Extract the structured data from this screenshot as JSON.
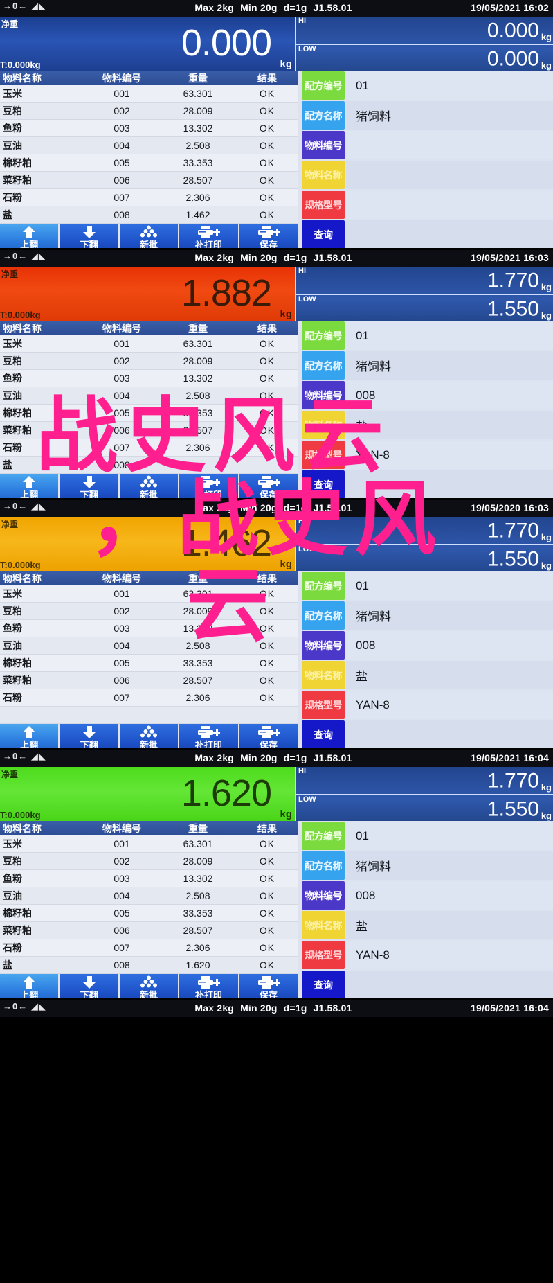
{
  "device": {
    "spec": {
      "max": "Max 2kg",
      "min": "Min 20g",
      "division": "d=1g",
      "version": "J1.58.01"
    },
    "status_icons": "→ 0 ←   ▼▼",
    "net_label": "净重",
    "unit": "kg",
    "hi_tag": "HI",
    "low_tag": "LOW"
  },
  "table": {
    "headers": [
      "物料名称",
      "物料编号",
      "重量",
      "结果"
    ]
  },
  "side_keys": [
    {
      "label": "配方编号",
      "color": "k-green"
    },
    {
      "label": "配方名称",
      "color": "k-blue"
    },
    {
      "label": "物料编号",
      "color": "k-purple"
    },
    {
      "label": "物料名称",
      "color": "k-yellow"
    },
    {
      "label": "规格型号",
      "color": "k-red"
    },
    {
      "label": "查询",
      "color": "k-navy"
    }
  ],
  "nav_buttons": [
    {
      "label": "上翻",
      "icon": "arrow-up-icon"
    },
    {
      "label": "下翻",
      "icon": "arrow-down-icon"
    },
    {
      "label": "新批",
      "icon": "batch-stack-icon"
    },
    {
      "label": "补打印",
      "icon": "printer-plus-icon"
    },
    {
      "label": "保存",
      "icon": "printer-plus-icon"
    }
  ],
  "watermark": {
    "line1": "战史风云",
    "line2": "，战史风",
    "line3": "云"
  },
  "colors": {
    "blue_display": "#2a55b5",
    "red_display": "#f04a12",
    "orange_display": "#f7b71a",
    "green_display": "#64e636",
    "watermark": "#ff1f8f",
    "key_green": "#7ada3e",
    "key_blue": "#36a3ee",
    "key_purple": "#4b37c8",
    "key_yellow": "#f0d433",
    "key_red": "#f03a42",
    "key_navy": "#1418c8"
  },
  "panels": [
    {
      "id": "panel-1",
      "datetime": "19/05/2021  16:02",
      "display_color": "blue",
      "weight": "0.000",
      "tare": "T:0.000kg",
      "hi": "0.000",
      "low": "0.000",
      "rows": [
        [
          "玉米",
          "001",
          "63.301",
          "OK"
        ],
        [
          "豆粕",
          "002",
          "28.009",
          "OK"
        ],
        [
          "鱼粉",
          "003",
          "13.302",
          "OK"
        ],
        [
          "豆油",
          "004",
          "2.508",
          "OK"
        ],
        [
          "棉籽粕",
          "005",
          "33.353",
          "OK"
        ],
        [
          "菜籽粕",
          "006",
          "28.507",
          "OK"
        ],
        [
          "石粉",
          "007",
          "2.306",
          "OK"
        ],
        [
          "盐",
          "008",
          "1.462",
          "OK"
        ]
      ],
      "fields": [
        "01",
        "猪饲料",
        "",
        "",
        "",
        ""
      ]
    },
    {
      "id": "panel-2",
      "datetime": "19/05/2021  16:03",
      "display_color": "red",
      "weight": "1.882",
      "tare": "T:0.000kg",
      "hi": "1.770",
      "low": "1.550",
      "rows": [
        [
          "玉米",
          "001",
          "63.301",
          "OK"
        ],
        [
          "豆粕",
          "002",
          "28.009",
          "OK"
        ],
        [
          "鱼粉",
          "003",
          "13.302",
          "OK"
        ],
        [
          "豆油",
          "004",
          "2.508",
          "OK"
        ],
        [
          "棉籽粕",
          "005",
          "33.353",
          "OK"
        ],
        [
          "菜籽粕",
          "006",
          "28.507",
          "OK"
        ],
        [
          "石粉",
          "007",
          "2.306",
          "OK"
        ],
        [
          "盐",
          "008",
          "",
          ""
        ]
      ],
      "fields": [
        "01",
        "猪饲料",
        "008",
        "盐",
        "YAN-8",
        ""
      ]
    },
    {
      "id": "panel-3",
      "datetime": "19/05/2020  16:03",
      "display_color": "orange",
      "weight": "1.462",
      "tare": "T:0.000kg",
      "hi": "1.770",
      "low": "1.550",
      "rows": [
        [
          "玉米",
          "001",
          "63.301",
          "OK"
        ],
        [
          "豆粕",
          "002",
          "28.009",
          "OK"
        ],
        [
          "鱼粉",
          "003",
          "13.302",
          "OK"
        ],
        [
          "豆油",
          "004",
          "2.508",
          "OK"
        ],
        [
          "棉籽粕",
          "005",
          "33.353",
          "OK"
        ],
        [
          "菜籽粕",
          "006",
          "28.507",
          "OK"
        ],
        [
          "石粉",
          "007",
          "2.306",
          "OK"
        ],
        [
          "",
          "",
          "",
          ""
        ]
      ],
      "fields": [
        "01",
        "猪饲料",
        "008",
        "盐",
        "YAN-8",
        ""
      ]
    },
    {
      "id": "panel-4",
      "datetime": "19/05/2021  16:04",
      "display_color": "green",
      "weight": "1.620",
      "tare": "T:0.000kg",
      "hi": "1.770",
      "low": "1.550",
      "rows": [
        [
          "玉米",
          "001",
          "63.301",
          "OK"
        ],
        [
          "豆粕",
          "002",
          "28.009",
          "OK"
        ],
        [
          "鱼粉",
          "003",
          "13.302",
          "OK"
        ],
        [
          "豆油",
          "004",
          "2.508",
          "OK"
        ],
        [
          "棉籽粕",
          "005",
          "33.353",
          "OK"
        ],
        [
          "菜籽粕",
          "006",
          "28.507",
          "OK"
        ],
        [
          "石粉",
          "007",
          "2.306",
          "OK"
        ],
        [
          "盐",
          "008",
          "1.620",
          "OK"
        ]
      ],
      "fields": [
        "01",
        "猪饲料",
        "008",
        "盐",
        "YAN-8",
        ""
      ]
    },
    {
      "id": "panel-5",
      "datetime": "19/05/2021  16:04",
      "display_color": "blue",
      "weight": "",
      "tare": "",
      "hi": "",
      "low": "",
      "rows": [],
      "fields": []
    }
  ]
}
